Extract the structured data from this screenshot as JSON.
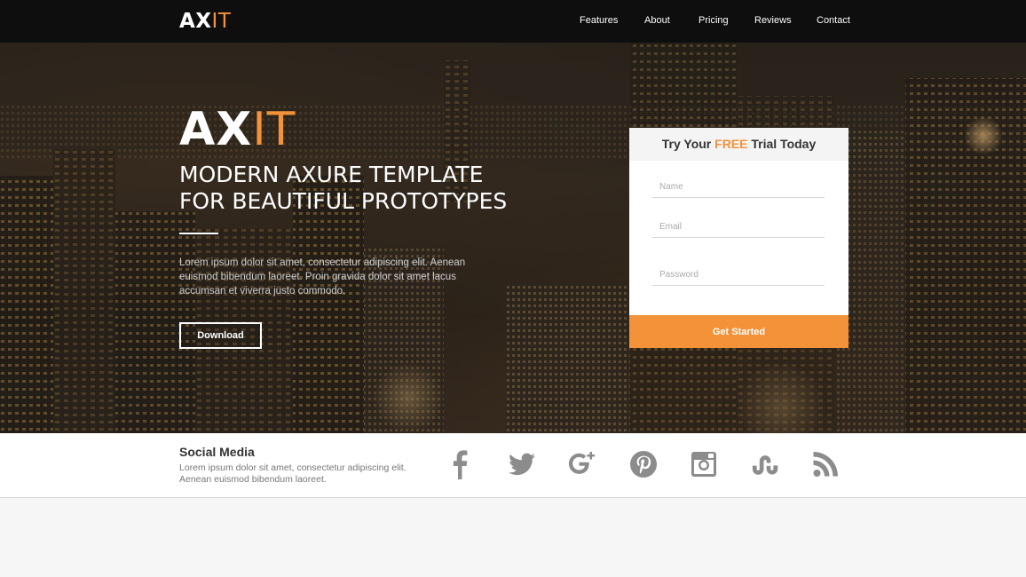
{
  "brand": {
    "name_main": "AX",
    "name_accent": "IT",
    "accent_color": "#f39239"
  },
  "nav": {
    "items": [
      {
        "label": "Features"
      },
      {
        "label": "About"
      },
      {
        "label": "Pricing"
      },
      {
        "label": "Reviews"
      },
      {
        "label": "Contact"
      }
    ]
  },
  "hero": {
    "title_main": "AX",
    "title_accent": "IT",
    "headline_line1": "MODERN AXURE TEMPLATE",
    "headline_line2": "FOR BEAUTIFUL PROTOTYPES",
    "body": "Lorem ipsum dolor sit amet, consectetur adipiscing elit. Aenean euismod bibendum laoreet. Proin gravida dolor sit amet lacus accumsan et viverra justo commodo.",
    "download_label": "Download"
  },
  "signup": {
    "title_before": "Try Your ",
    "title_highlight": "FREE",
    "title_after": " Trial Today",
    "name_placeholder": "Name",
    "email_placeholder": "Email",
    "password_placeholder": "Password",
    "submit_label": "Get Started"
  },
  "social": {
    "title": "Social Media",
    "text": "Lorem ipsum dolor sit amet, consectetur adipiscing elit. Aenean euismod bibendum laoreet.",
    "icons": [
      "facebook-icon",
      "twitter-icon",
      "google-plus-icon",
      "pinterest-icon",
      "instagram-icon",
      "stumbleupon-icon",
      "rss-icon"
    ]
  },
  "colors": {
    "nav_bg": "#0e0e0e",
    "accent": "#f39239",
    "icon_gray": "#8c8c8c"
  }
}
